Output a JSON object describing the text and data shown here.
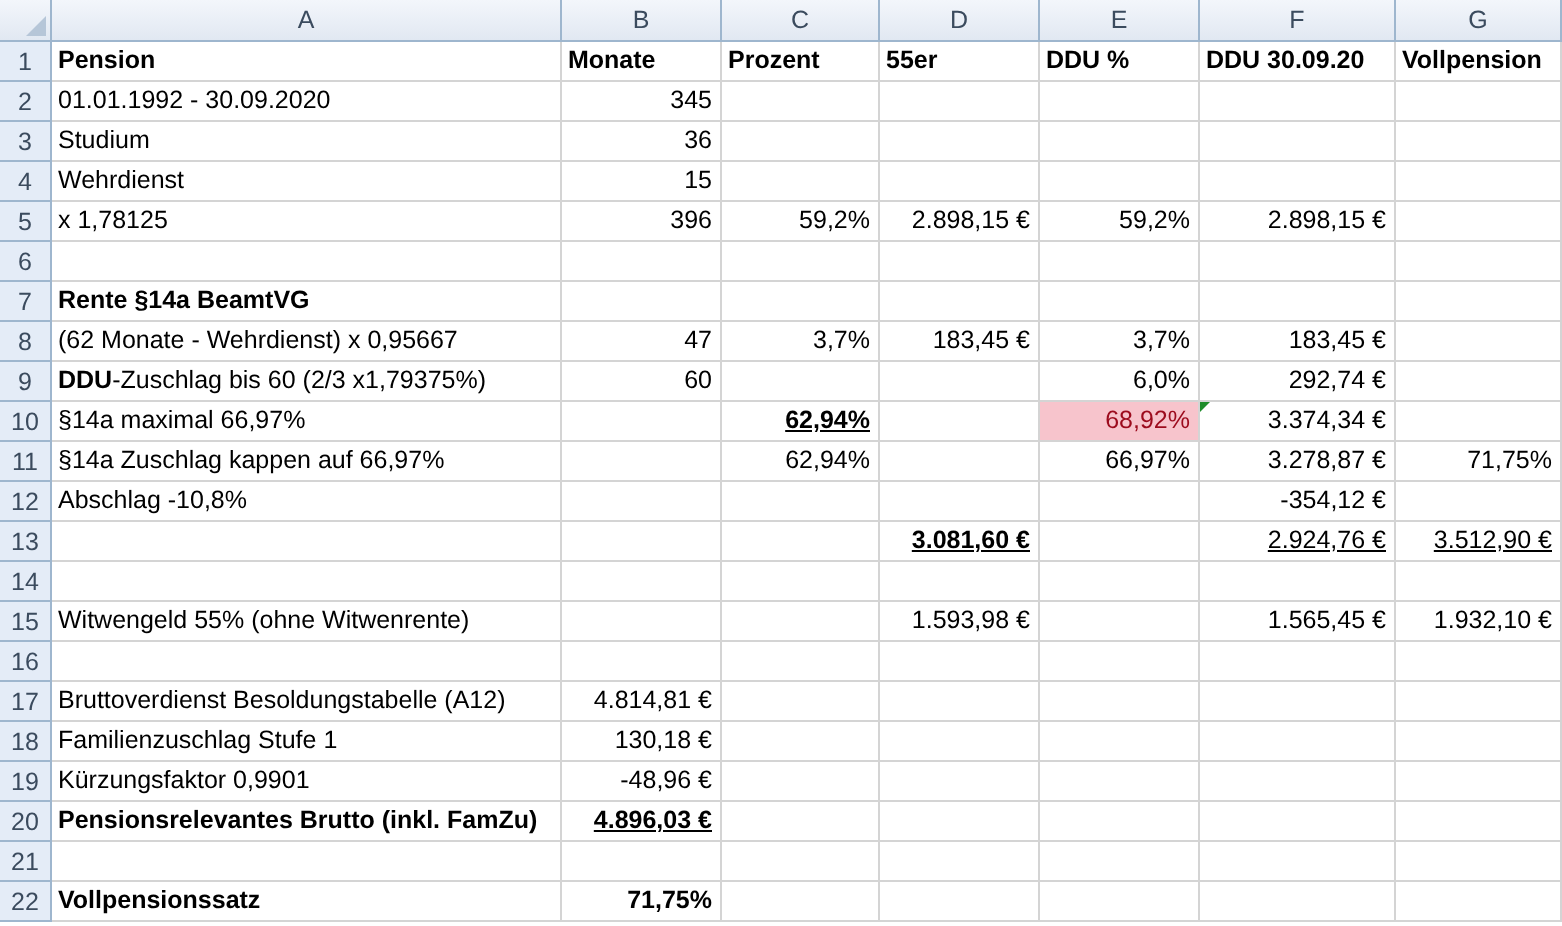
{
  "columns": [
    {
      "label": "A",
      "selected": false
    },
    {
      "label": "B",
      "selected": false
    },
    {
      "label": "C",
      "selected": false
    },
    {
      "label": "D",
      "selected": false
    },
    {
      "label": "E",
      "selected": false
    },
    {
      "label": "F",
      "selected": false
    },
    {
      "label": "G",
      "selected": false
    }
  ],
  "rows": [
    {
      "number": "1",
      "cells": [
        {
          "text": "Pension",
          "kind": "label",
          "bold": true,
          "underline": false
        },
        {
          "text": "Monate",
          "kind": "label",
          "bold": true,
          "underline": false
        },
        {
          "text": "Prozent",
          "kind": "label",
          "bold": true,
          "underline": false
        },
        {
          "text": "55er",
          "kind": "label",
          "bold": true,
          "underline": false
        },
        {
          "text": "DDU %",
          "kind": "label",
          "bold": true,
          "underline": false
        },
        {
          "text": "DDU 30.09.20",
          "kind": "label",
          "bold": true,
          "underline": false
        },
        {
          "text": "Vollpension",
          "kind": "label",
          "bold": true,
          "underline": false
        }
      ]
    },
    {
      "number": "2",
      "cells": [
        {
          "text": "01.01.1992 - 30.09.2020",
          "kind": "label",
          "bold": false,
          "underline": false
        },
        {
          "text": "345",
          "kind": "number",
          "bold": false,
          "underline": false
        },
        null,
        null,
        null,
        null,
        null
      ]
    },
    {
      "number": "3",
      "cells": [
        {
          "text": "Studium",
          "kind": "label",
          "bold": false,
          "underline": false
        },
        {
          "text": "36",
          "kind": "number",
          "bold": false,
          "underline": false
        },
        null,
        null,
        null,
        null,
        null
      ]
    },
    {
      "number": "4",
      "cells": [
        {
          "text": "Wehrdienst",
          "kind": "label",
          "bold": false,
          "underline": false
        },
        {
          "text": "15",
          "kind": "number",
          "bold": false,
          "underline": false
        },
        null,
        null,
        null,
        null,
        null
      ]
    },
    {
      "number": "5",
      "cells": [
        {
          "text": "x 1,78125",
          "kind": "label",
          "bold": false,
          "underline": false
        },
        {
          "text": "396",
          "kind": "number",
          "bold": false,
          "underline": false
        },
        {
          "text": "59,2%",
          "kind": "number",
          "bold": false,
          "underline": false
        },
        {
          "text": "2.898,15 €",
          "kind": "number",
          "bold": false,
          "underline": false
        },
        {
          "text": "59,2%",
          "kind": "number",
          "bold": false,
          "underline": false
        },
        {
          "text": "2.898,15 €",
          "kind": "number",
          "bold": false,
          "underline": false
        },
        null
      ]
    },
    {
      "number": "6",
      "cells": [
        null,
        null,
        null,
        null,
        null,
        null,
        null
      ]
    },
    {
      "number": "7",
      "cells": [
        {
          "text": "Rente §14a BeamtVG",
          "kind": "label",
          "bold": true,
          "underline": false
        },
        null,
        null,
        null,
        null,
        null,
        null
      ]
    },
    {
      "number": "8",
      "cells": [
        {
          "text": "(62 Monate - Wehrdienst) x 0,95667",
          "kind": "label",
          "bold": false,
          "underline": false
        },
        {
          "text": "47",
          "kind": "number",
          "bold": false,
          "underline": false
        },
        {
          "text": "3,7%",
          "kind": "number",
          "bold": false,
          "underline": false
        },
        {
          "text": "183,45 €",
          "kind": "number",
          "bold": false,
          "underline": false
        },
        {
          "text": "3,7%",
          "kind": "number",
          "bold": false,
          "underline": false
        },
        {
          "text": "183,45 €",
          "kind": "number",
          "bold": false,
          "underline": false
        },
        null
      ]
    },
    {
      "number": "9",
      "cells": [
        {
          "text": "**DDU**-Zuschlag bis 60 (2/3 x1,79375%)",
          "kind": "label",
          "bold": false,
          "underline": false
        },
        {
          "text": "60",
          "kind": "number",
          "bold": false,
          "underline": false
        },
        null,
        null,
        {
          "text": "6,0%",
          "kind": "number",
          "bold": false,
          "underline": false
        },
        {
          "text": "292,74 €",
          "kind": "number",
          "bold": false,
          "underline": false
        },
        null
      ]
    },
    {
      "number": "10",
      "cells": [
        {
          "text": "§14a maximal 66,97%",
          "kind": "label",
          "bold": false,
          "underline": false
        },
        null,
        {
          "text": "62,94%",
          "kind": "number",
          "bold": true,
          "underline": true
        },
        null,
        {
          "text": "68,92%",
          "kind": "number",
          "bold": false,
          "underline": false,
          "highlighted": true
        },
        {
          "text": "3.374,34 €",
          "kind": "number",
          "bold": false,
          "underline": false,
          "flagged": true
        },
        null
      ]
    },
    {
      "number": "11",
      "cells": [
        {
          "text": "§14a Zuschlag kappen auf 66,97%",
          "kind": "label",
          "bold": false,
          "underline": false
        },
        null,
        {
          "text": "62,94%",
          "kind": "number",
          "bold": false,
          "underline": false
        },
        null,
        {
          "text": "66,97%",
          "kind": "number",
          "bold": false,
          "underline": false
        },
        {
          "text": "3.278,87 €",
          "kind": "number",
          "bold": false,
          "underline": false
        },
        {
          "text": "71,75%",
          "kind": "number",
          "bold": false,
          "underline": false
        }
      ]
    },
    {
      "number": "12",
      "cells": [
        {
          "text": "Abschlag -10,8%",
          "kind": "label",
          "bold": false,
          "underline": false
        },
        null,
        null,
        null,
        null,
        {
          "text": "-354,12 €",
          "kind": "number",
          "bold": false,
          "underline": false
        },
        null
      ]
    },
    {
      "number": "13",
      "cells": [
        null,
        null,
        null,
        {
          "text": "3.081,60 €",
          "kind": "number",
          "bold": true,
          "underline": true
        },
        null,
        {
          "text": "2.924,76 €",
          "kind": "number",
          "bold": false,
          "underline": true
        },
        {
          "text": "3.512,90 €",
          "kind": "number",
          "bold": false,
          "underline": true
        }
      ]
    },
    {
      "number": "14",
      "cells": [
        null,
        null,
        null,
        null,
        null,
        null,
        null
      ]
    },
    {
      "number": "15",
      "cells": [
        {
          "text": "Witwengeld 55% (ohne Witwenrente)",
          "kind": "label",
          "bold": false,
          "underline": false
        },
        null,
        null,
        {
          "text": "1.593,98 €",
          "kind": "number",
          "bold": false,
          "underline": false
        },
        null,
        {
          "text": "1.565,45 €",
          "kind": "number",
          "bold": false,
          "underline": false
        },
        {
          "text": "1.932,10 €",
          "kind": "number",
          "bold": false,
          "underline": false
        }
      ]
    },
    {
      "number": "16",
      "cells": [
        null,
        null,
        null,
        null,
        null,
        null,
        null
      ]
    },
    {
      "number": "17",
      "cells": [
        {
          "text": "Bruttoverdienst Besoldungstabelle (A12)",
          "kind": "label",
          "bold": false,
          "underline": false
        },
        {
          "text": "4.814,81 €",
          "kind": "number",
          "bold": false,
          "underline": false
        },
        null,
        null,
        null,
        null,
        null
      ]
    },
    {
      "number": "18",
      "cells": [
        {
          "text": "Familienzuschlag Stufe 1",
          "kind": "label",
          "bold": false,
          "underline": false
        },
        {
          "text": "130,18 €",
          "kind": "number",
          "bold": false,
          "underline": false
        },
        null,
        null,
        null,
        null,
        null
      ]
    },
    {
      "number": "19",
      "cells": [
        {
          "text": "Kürzungsfaktor 0,9901",
          "kind": "label",
          "bold": false,
          "underline": false
        },
        {
          "text": "-48,96 €",
          "kind": "number",
          "bold": false,
          "underline": false
        },
        null,
        null,
        null,
        null,
        null
      ]
    },
    {
      "number": "20",
      "cells": [
        {
          "text": "Pensionsrelevantes Brutto (inkl. FamZu)",
          "kind": "label",
          "bold": true,
          "underline": false
        },
        {
          "text": "4.896,03 €",
          "kind": "number",
          "bold": true,
          "underline": true
        },
        null,
        null,
        null,
        null,
        null
      ]
    },
    {
      "number": "21",
      "cells": [
        null,
        null,
        null,
        null,
        null,
        null,
        null
      ]
    },
    {
      "number": "22",
      "cells": [
        {
          "text": "Vollpensionssatz",
          "kind": "label",
          "bold": true,
          "underline": false
        },
        {
          "text": "71,75%",
          "kind": "number",
          "bold": true,
          "underline": false
        },
        null,
        null,
        null,
        null,
        null
      ]
    }
  ]
}
